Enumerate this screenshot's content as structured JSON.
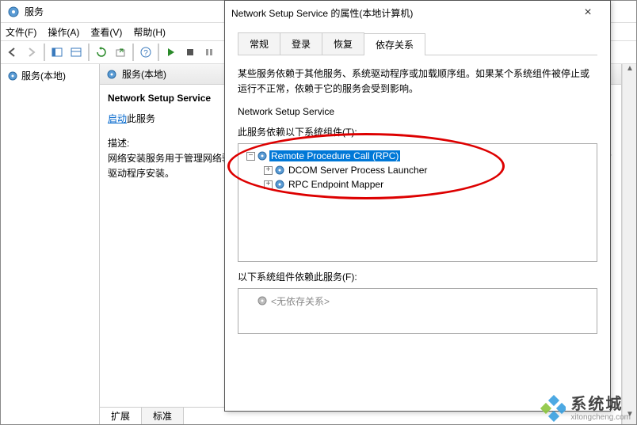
{
  "main": {
    "title": "服务",
    "menus": {
      "file": "文件(F)",
      "action": "操作(A)",
      "view": "查看(V)",
      "help": "帮助(H)"
    }
  },
  "leftPane": {
    "label": "服务(本地)"
  },
  "centerPane": {
    "header": "服务(本地)",
    "serviceTitle": "Network Setup Service",
    "startLink": "启动",
    "startSuffix": "此服务",
    "descLabel": "描述:",
    "desc": "网络安装服务用于管理网络驱动程序的安装，并允许配置低级别网络设置。如果停止此服务，可能会取消正在进行的所有驱动程序安装。",
    "tabs": {
      "extended": "扩展",
      "standard": "标准"
    }
  },
  "dialog": {
    "title": "Network Setup Service 的属性(本地计算机)",
    "tabs": {
      "general": "常规",
      "logon": "登录",
      "recovery": "恢复",
      "dependencies": "依存关系"
    },
    "info": "某些服务依赖于其他服务、系统驱动程序或加载顺序组。如果某个系统组件被停止或运行不正常，依赖于它的服务会受到影响。",
    "serviceName": "Network Setup Service",
    "dependsLabel": "此服务依赖以下系统组件(T):",
    "deps": {
      "rpc": "Remote Procedure Call (RPC)",
      "dcom": "DCOM Server Process Launcher",
      "endpoint": "RPC Endpoint Mapper"
    },
    "dependedLabel": "以下系统组件依赖此服务(F):",
    "noDeps": "<无依存关系>"
  },
  "watermark": {
    "main": "系统城",
    "sub": "xitongcheng.com"
  }
}
